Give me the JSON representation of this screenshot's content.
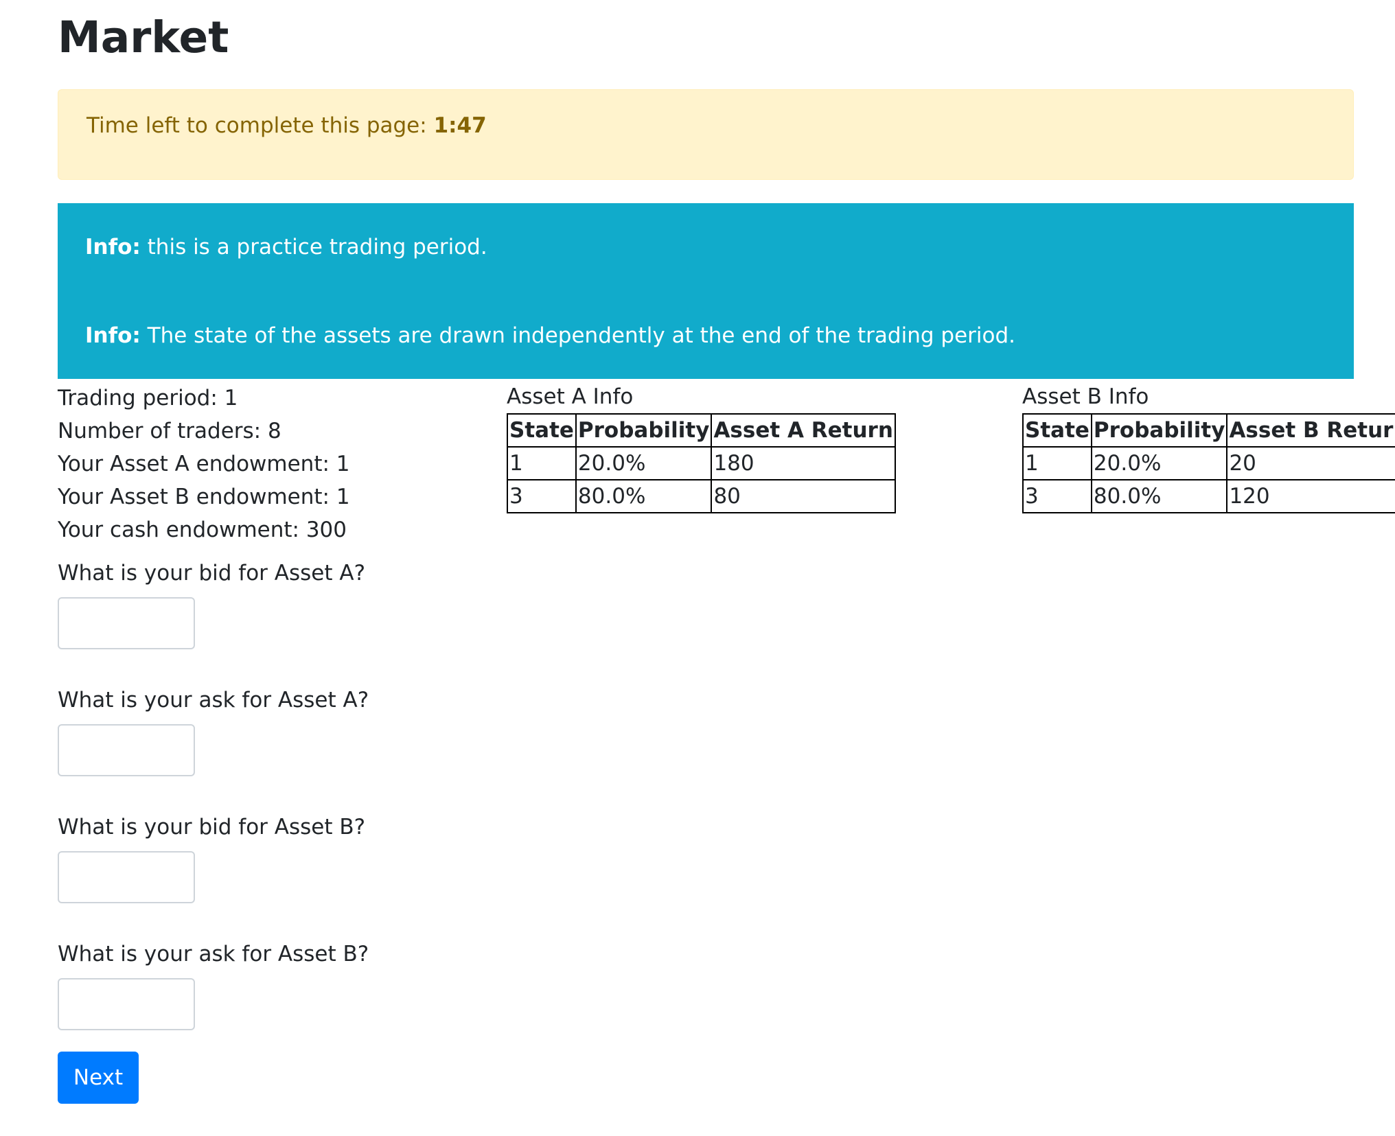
{
  "page": {
    "title": "Market"
  },
  "timer": {
    "label": "Time left to complete this page: ",
    "value": "1:47"
  },
  "info": [
    {
      "prefix": "Info:",
      "text": " this is a practice trading period."
    },
    {
      "prefix": "Info:",
      "text": " The state of the assets are drawn independently at the end of the trading period."
    }
  ],
  "stats": [
    "Trading period: 1",
    "Number of traders: 8",
    "Your Asset A endowment: 1",
    "Your Asset B endowment: 1",
    "Your cash endowment: 300"
  ],
  "asset_a": {
    "title": "Asset A Info",
    "headers": [
      "State",
      "Probability",
      "Asset A Return"
    ],
    "rows": [
      [
        "1",
        "20.0%",
        "180"
      ],
      [
        "3",
        "80.0%",
        "80"
      ]
    ]
  },
  "asset_b": {
    "title": "Asset B Info",
    "headers": [
      "State",
      "Probability",
      "Asset B Return"
    ],
    "rows": [
      [
        "1",
        "20.0%",
        "20"
      ],
      [
        "3",
        "80.0%",
        "120"
      ]
    ]
  },
  "questions": [
    {
      "label": "What is your bid for Asset A?",
      "value": ""
    },
    {
      "label": "What is your ask for Asset A?",
      "value": ""
    },
    {
      "label": "What is your bid for Asset B?",
      "value": ""
    },
    {
      "label": "What is your ask for Asset B?",
      "value": ""
    }
  ],
  "buttons": {
    "next_label": "Next"
  },
  "colors": {
    "warning_bg": "#fff3cd",
    "warning_text": "#856404",
    "info_bg": "#11abcb",
    "primary": "#007bff"
  }
}
